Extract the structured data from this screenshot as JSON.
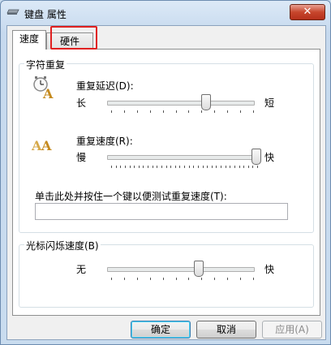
{
  "window": {
    "title": "键盘 属性",
    "close_symbol": "✕"
  },
  "tabs": [
    {
      "label": "速度",
      "active": true
    },
    {
      "label": "硬件",
      "active": false,
      "highlighted": true
    }
  ],
  "char_repeat": {
    "group_title": "字符重复",
    "delay": {
      "label": "重复延迟(D):",
      "min_label": "长",
      "max_label": "短",
      "value_fraction": 0.67
    },
    "rate": {
      "label": "重复速度(R):",
      "min_label": "慢",
      "max_label": "快",
      "value_fraction": 1.0
    },
    "test_label": "单击此处并按住一个键以便测试重复速度(T):",
    "test_value": ""
  },
  "cursor": {
    "group_title": "光标闪烁速度(B)",
    "min_label": "无",
    "max_label": "快",
    "value_fraction": 0.62
  },
  "buttons": {
    "ok": "确定",
    "cancel": "取消",
    "apply": "应用(A)"
  },
  "colors": {
    "highlight_border": "#e02020",
    "accent": "#3c7fb1"
  },
  "icons": {
    "delay": "repeat-delay-icon",
    "rate": "repeat-rate-icon",
    "window": "keyboard-icon"
  }
}
